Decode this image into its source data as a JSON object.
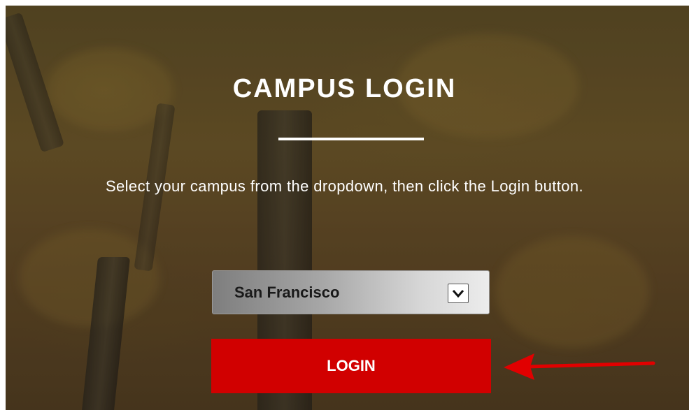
{
  "page": {
    "title": "CAMPUS LOGIN",
    "instruction": "Select your campus from the dropdown, then click the Login button."
  },
  "campus_select": {
    "selected": "San Francisco",
    "arrow_icon": "chevron-down-icon"
  },
  "login_button": {
    "label": "LOGIN",
    "color": "#d10000"
  },
  "annotation": {
    "icon": "red-arrow-icon",
    "color": "#e10000",
    "points_to": "login-button"
  }
}
